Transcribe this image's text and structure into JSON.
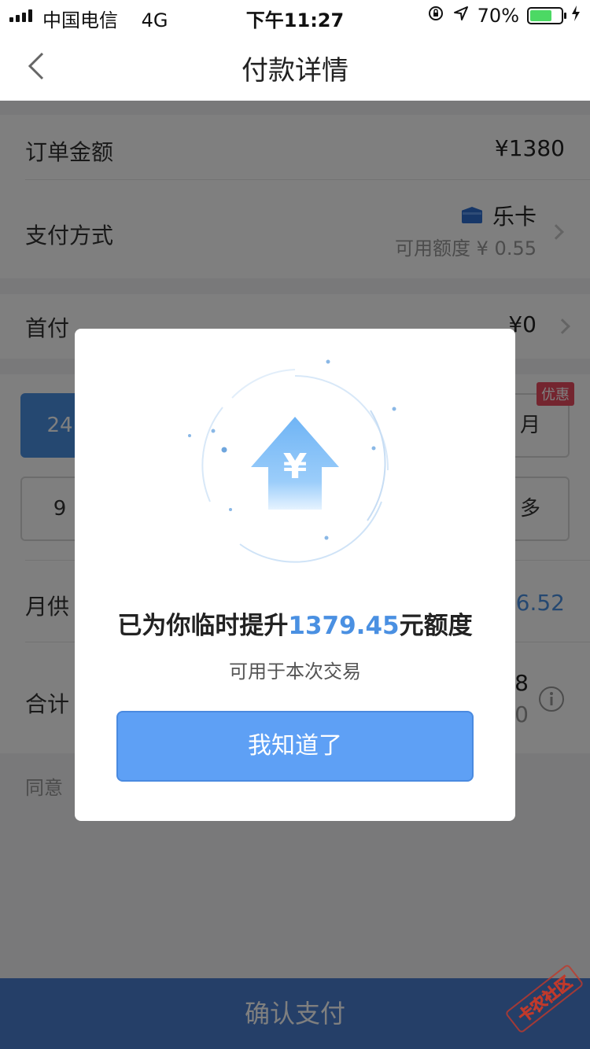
{
  "status_bar": {
    "carrier": "中国电信",
    "network": "4G",
    "time": "下午11:27",
    "battery_percent": "70%",
    "battery_level": 0.7
  },
  "nav": {
    "title": "付款详情"
  },
  "order": {
    "amount_label": "订单金额",
    "amount_value": "¥1380",
    "payment_label": "支付方式",
    "payment_method": "乐卡",
    "available_credit": "可用额度 ¥ 0.55"
  },
  "down_payment": {
    "label": "首付",
    "value": "¥0"
  },
  "periods": {
    "row1_left": "24",
    "row1_right": "月",
    "row2_left": "9",
    "row2_right": "多",
    "promo_badge": "优惠"
  },
  "summary": {
    "monthly_label": "月供",
    "monthly_value": "6.52",
    "total_label": "合计",
    "total_value_1": "8",
    "total_value_2": "0",
    "agree_text": "同意"
  },
  "bottom": {
    "confirm_label": "确认支付"
  },
  "modal": {
    "headline_before": "已为你临时提升",
    "headline_amount": "1379.45",
    "headline_after": "元额度",
    "subtitle": "可用于本次交易",
    "button": "我知道了",
    "icon_symbol": "¥"
  },
  "watermark": {
    "text": "卡农社区"
  },
  "colors": {
    "accent": "#4a90e2",
    "promo": "#e84a5f",
    "confirm_bar": "#4a7fd0"
  }
}
